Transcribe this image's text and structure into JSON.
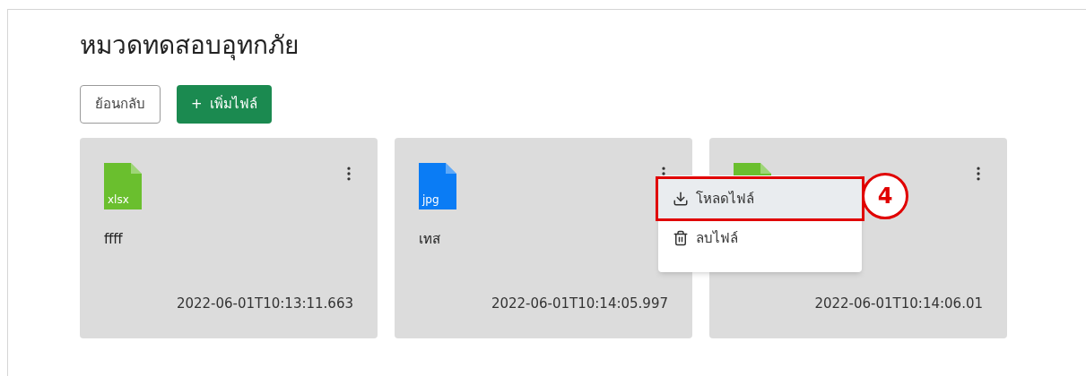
{
  "title": "หมวดทดสอบอุทกภัย",
  "buttons": [
    {
      "kind": "outline",
      "label": "ย้อนกลับ"
    },
    {
      "kind": "primary",
      "icon": "+",
      "label": "เพิ่มไฟล์"
    }
  ],
  "files": [
    {
      "ext": "xlsx",
      "color": "#6abf2e",
      "name": "ffff",
      "date": "2022-06-01T10:13:11.663",
      "menu_open": false
    },
    {
      "ext": "jpg",
      "color": "#0a7cf5",
      "name": "เทส",
      "date": "2022-06-01T10:14:05.997",
      "menu_open": true
    },
    {
      "color": "#6abf2e",
      "date": "2022-06-01T10:14:06.01",
      "menu_open": false
    }
  ],
  "menu": {
    "items": [
      {
        "kind": "download",
        "label": "โหลดไฟล์",
        "highlighted": true
      },
      {
        "kind": "delete",
        "label": "ลบไฟล์",
        "highlighted": false
      }
    ],
    "callout": "4"
  }
}
